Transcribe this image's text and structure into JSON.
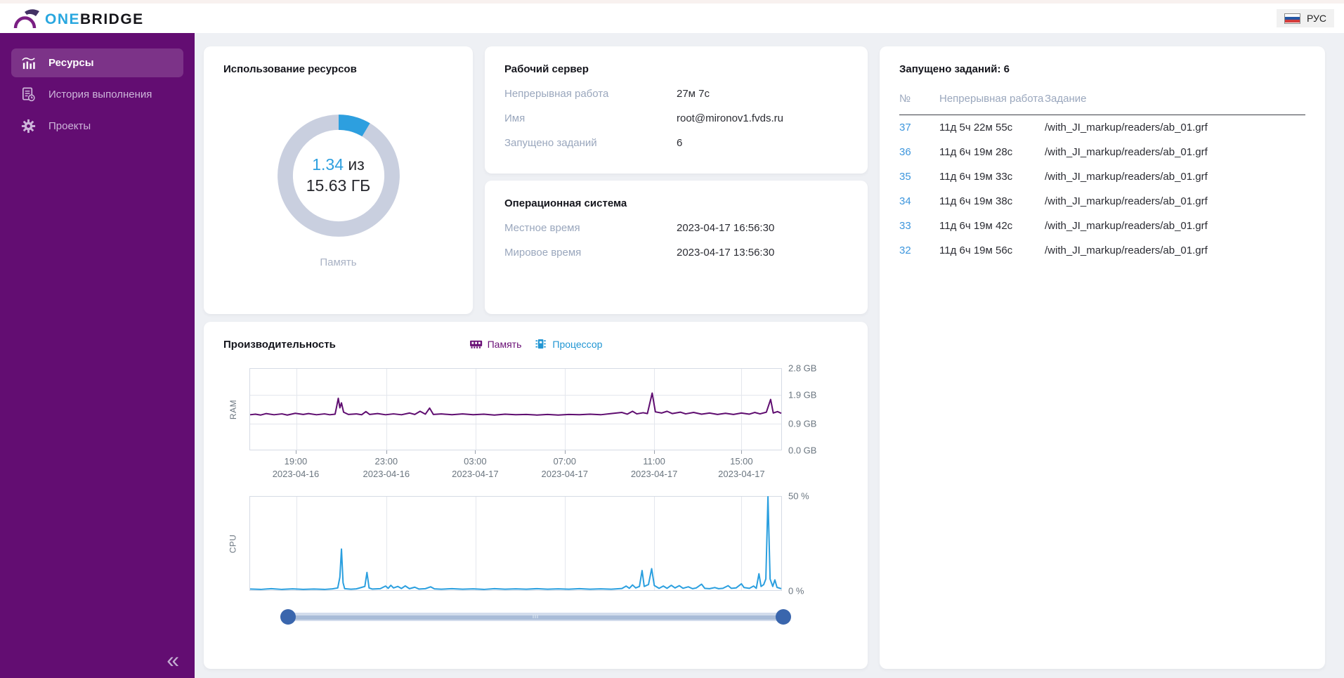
{
  "header": {
    "logo_one": "ONE",
    "logo_bridge": "BRIDGE",
    "lang": {
      "label": "РУС",
      "flag": "russia-flag"
    }
  },
  "sidebar": {
    "items": [
      {
        "label": "Ресурсы",
        "icon": "chart-icon",
        "active": true
      },
      {
        "label": "История выполнения",
        "icon": "history-icon",
        "active": false
      },
      {
        "label": "Проекты",
        "icon": "projects-gear-icon",
        "active": false
      }
    ],
    "collapse_glyph": "«"
  },
  "cards": {
    "resources": {
      "title": "Использование ресурсов"
    },
    "server": {
      "title": "Рабочий сервер",
      "rows": [
        {
          "label": "Непрерывная работа",
          "value": "27м 7с"
        },
        {
          "label": "Имя",
          "value": "root@mironov1.fvds.ru"
        },
        {
          "label": "Запущено заданий",
          "value": "6"
        }
      ]
    },
    "os": {
      "title": "Операционная система",
      "rows": [
        {
          "label": "Местное время",
          "value": "2023-04-17 16:56:30"
        },
        {
          "label": "Мировое время",
          "value": "2023-04-17 13:56:30"
        }
      ]
    },
    "performance": {
      "title": "Производительность"
    }
  },
  "jobs_panel": {
    "title": "Запущено заданий: 6",
    "columns": [
      "№",
      "Непрерывная работа",
      "Задание"
    ],
    "rows": [
      {
        "num": "37",
        "uptime": "11д 5ч 22м 55с",
        "task": "/with_JI_markup/readers/ab_01.grf"
      },
      {
        "num": "36",
        "uptime": "11д 6ч 19м 28с",
        "task": "/with_JI_markup/readers/ab_01.grf"
      },
      {
        "num": "35",
        "uptime": "11д 6ч 19м 33с",
        "task": "/with_JI_markup/readers/ab_01.grf"
      },
      {
        "num": "34",
        "uptime": "11д 6ч 19м 38с",
        "task": "/with_JI_markup/readers/ab_01.grf"
      },
      {
        "num": "33",
        "uptime": "11д 6ч 19м 42с",
        "task": "/with_JI_markup/readers/ab_01.grf"
      },
      {
        "num": "32",
        "uptime": "11д 6ч 19м 56с",
        "task": "/with_JI_markup/readers/ab_01.grf"
      }
    ]
  },
  "colors": {
    "sidebar_purple": "#630d72",
    "accent_blue": "#2d9fdf",
    "link_blue": "#3d96dd",
    "label_gray": "#9aa7bd",
    "ram_line_purple": "#5f0d70",
    "cpu_line_blue": "#2a9fdf",
    "donut_track_gray": "#c9cfdf",
    "slider_handle_blue": "#3a66ad"
  },
  "chart_data": [
    {
      "type": "donut",
      "id": "memory-donut",
      "used_gb": 1.34,
      "total_gb": 15.63,
      "center_value": "1.34",
      "center_sep": "из",
      "center_total": "15.63 ГБ",
      "label": "Память",
      "colors": {
        "used": "#2d9fdf",
        "rest": "#c9cfdf"
      }
    },
    {
      "type": "line",
      "id": "ram",
      "series_name": "Память",
      "color": "#5f0d70",
      "ylabel": "RAM",
      "ymax": 2.8,
      "yticks": [
        "2.8 GB",
        "1.9 GB",
        "0.9 GB",
        "0.0 GB"
      ],
      "ytick_values": [
        2.8,
        1.9,
        0.9,
        0.0
      ],
      "grid_y": [
        1.9,
        0.9
      ],
      "xgrid": [
        0.087,
        0.257,
        0.424,
        0.592,
        0.76,
        0.924
      ],
      "x_ticks": [
        {
          "time": "19:00",
          "date": "2023-04-16",
          "pos": 0.087
        },
        {
          "time": "23:00",
          "date": "2023-04-16",
          "pos": 0.257
        },
        {
          "time": "03:00",
          "date": "2023-04-17",
          "pos": 0.424
        },
        {
          "time": "07:00",
          "date": "2023-04-17",
          "pos": 0.592
        },
        {
          "time": "11:00",
          "date": "2023-04-17",
          "pos": 0.76
        },
        {
          "time": "15:00",
          "date": "2023-04-17",
          "pos": 0.924
        }
      ],
      "points": [
        [
          0,
          1.21
        ],
        [
          0.01,
          1.23
        ],
        [
          0.02,
          1.2
        ],
        [
          0.03,
          1.25
        ],
        [
          0.045,
          1.21
        ],
        [
          0.06,
          1.24
        ],
        [
          0.07,
          1.2
        ],
        [
          0.085,
          1.26
        ],
        [
          0.1,
          1.22
        ],
        [
          0.11,
          1.25
        ],
        [
          0.125,
          1.21
        ],
        [
          0.14,
          1.24
        ],
        [
          0.15,
          1.21
        ],
        [
          0.16,
          1.23
        ],
        [
          0.163,
          1.5
        ],
        [
          0.166,
          1.78
        ],
        [
          0.169,
          1.45
        ],
        [
          0.172,
          1.62
        ],
        [
          0.176,
          1.3
        ],
        [
          0.185,
          1.22
        ],
        [
          0.2,
          1.24
        ],
        [
          0.21,
          1.21
        ],
        [
          0.218,
          1.32
        ],
        [
          0.225,
          1.22
        ],
        [
          0.24,
          1.25
        ],
        [
          0.255,
          1.21
        ],
        [
          0.27,
          1.24
        ],
        [
          0.285,
          1.21
        ],
        [
          0.3,
          1.27
        ],
        [
          0.31,
          1.22
        ],
        [
          0.32,
          1.33
        ],
        [
          0.33,
          1.23
        ],
        [
          0.338,
          1.44
        ],
        [
          0.345,
          1.22
        ],
        [
          0.36,
          1.24
        ],
        [
          0.38,
          1.21
        ],
        [
          0.4,
          1.24
        ],
        [
          0.42,
          1.21
        ],
        [
          0.44,
          1.23
        ],
        [
          0.46,
          1.2
        ],
        [
          0.48,
          1.23
        ],
        [
          0.5,
          1.21
        ],
        [
          0.52,
          1.22
        ],
        [
          0.54,
          1.2
        ],
        [
          0.56,
          1.22
        ],
        [
          0.58,
          1.2
        ],
        [
          0.6,
          1.22
        ],
        [
          0.62,
          1.21
        ],
        [
          0.64,
          1.23
        ],
        [
          0.66,
          1.21
        ],
        [
          0.68,
          1.25
        ],
        [
          0.7,
          1.29
        ],
        [
          0.71,
          1.23
        ],
        [
          0.72,
          1.33
        ],
        [
          0.728,
          1.24
        ],
        [
          0.74,
          1.28
        ],
        [
          0.748,
          1.25
        ],
        [
          0.757,
          1.96
        ],
        [
          0.763,
          1.31
        ],
        [
          0.775,
          1.27
        ],
        [
          0.785,
          1.33
        ],
        [
          0.795,
          1.25
        ],
        [
          0.81,
          1.3
        ],
        [
          0.82,
          1.24
        ],
        [
          0.835,
          1.29
        ],
        [
          0.85,
          1.23
        ],
        [
          0.865,
          1.27
        ],
        [
          0.88,
          1.22
        ],
        [
          0.895,
          1.26
        ],
        [
          0.91,
          1.22
        ],
        [
          0.925,
          1.27
        ],
        [
          0.94,
          1.23
        ],
        [
          0.95,
          1.29
        ],
        [
          0.96,
          1.24
        ],
        [
          0.972,
          1.3
        ],
        [
          0.98,
          1.74
        ],
        [
          0.985,
          1.27
        ],
        [
          0.993,
          1.32
        ],
        [
          1,
          1.26
        ]
      ]
    },
    {
      "type": "line",
      "id": "cpu",
      "series_name": "Процессор",
      "color": "#2a9fdf",
      "ylabel": "CPU",
      "ymax": 50,
      "yticks": [
        "50 %",
        "0 %"
      ],
      "ytick_values": [
        50,
        0
      ],
      "grid_y": [],
      "xgrid": [
        0.087,
        0.257,
        0.424,
        0.592,
        0.76,
        0.924
      ],
      "points": [
        [
          0,
          0.6
        ],
        [
          0.02,
          0.4
        ],
        [
          0.04,
          0.8
        ],
        [
          0.06,
          0.4
        ],
        [
          0.08,
          0.7
        ],
        [
          0.1,
          0.4
        ],
        [
          0.12,
          0.6
        ],
        [
          0.14,
          0.4
        ],
        [
          0.155,
          0.7
        ],
        [
          0.165,
          1.2
        ],
        [
          0.169,
          7
        ],
        [
          0.172,
          22
        ],
        [
          0.175,
          4
        ],
        [
          0.178,
          0.8
        ],
        [
          0.19,
          0.5
        ],
        [
          0.2,
          0.7
        ],
        [
          0.21,
          1.5
        ],
        [
          0.216,
          2
        ],
        [
          0.22,
          9.5
        ],
        [
          0.224,
          1.2
        ],
        [
          0.23,
          0.6
        ],
        [
          0.245,
          0.8
        ],
        [
          0.255,
          2.2
        ],
        [
          0.26,
          1
        ],
        [
          0.265,
          2.6
        ],
        [
          0.27,
          1.2
        ],
        [
          0.278,
          2
        ],
        [
          0.285,
          0.9
        ],
        [
          0.292,
          2.3
        ],
        [
          0.3,
          0.8
        ],
        [
          0.31,
          1.6
        ],
        [
          0.318,
          0.6
        ],
        [
          0.33,
          0.8
        ],
        [
          0.34,
          1.8
        ],
        [
          0.347,
          0.7
        ],
        [
          0.36,
          0.5
        ],
        [
          0.38,
          0.8
        ],
        [
          0.4,
          0.5
        ],
        [
          0.42,
          0.7
        ],
        [
          0.44,
          0.4
        ],
        [
          0.46,
          0.8
        ],
        [
          0.48,
          0.5
        ],
        [
          0.5,
          0.7
        ],
        [
          0.52,
          0.5
        ],
        [
          0.54,
          0.8
        ],
        [
          0.56,
          0.5
        ],
        [
          0.58,
          0.7
        ],
        [
          0.6,
          0.5
        ],
        [
          0.62,
          0.8
        ],
        [
          0.64,
          0.5
        ],
        [
          0.66,
          0.7
        ],
        [
          0.68,
          0.5
        ],
        [
          0.7,
          0.9
        ],
        [
          0.708,
          2.2
        ],
        [
          0.714,
          1
        ],
        [
          0.72,
          2.8
        ],
        [
          0.726,
          1.2
        ],
        [
          0.733,
          2
        ],
        [
          0.738,
          10.5
        ],
        [
          0.742,
          2
        ],
        [
          0.75,
          3
        ],
        [
          0.756,
          11.5
        ],
        [
          0.761,
          2.5
        ],
        [
          0.77,
          1
        ],
        [
          0.778,
          2.2
        ],
        [
          0.785,
          1
        ],
        [
          0.793,
          2.6
        ],
        [
          0.8,
          1.2
        ],
        [
          0.808,
          2.4
        ],
        [
          0.815,
          1
        ],
        [
          0.825,
          1.8
        ],
        [
          0.833,
          0.8
        ],
        [
          0.84,
          1.2
        ],
        [
          0.85,
          3.2
        ],
        [
          0.856,
          1
        ],
        [
          0.865,
          0.8
        ],
        [
          0.875,
          1.4
        ],
        [
          0.882,
          0.8
        ],
        [
          0.89,
          1
        ],
        [
          0.9,
          2.4
        ],
        [
          0.906,
          1
        ],
        [
          0.915,
          1.2
        ],
        [
          0.925,
          3.4
        ],
        [
          0.93,
          1.4
        ],
        [
          0.94,
          1
        ],
        [
          0.948,
          2.2
        ],
        [
          0.953,
          1
        ],
        [
          0.958,
          8.8
        ],
        [
          0.962,
          2
        ],
        [
          0.967,
          3
        ],
        [
          0.971,
          6
        ],
        [
          0.975,
          50
        ],
        [
          0.979,
          6
        ],
        [
          0.984,
          2
        ],
        [
          0.988,
          5.5
        ],
        [
          0.992,
          1.5
        ],
        [
          1,
          0.8
        ]
      ]
    }
  ]
}
